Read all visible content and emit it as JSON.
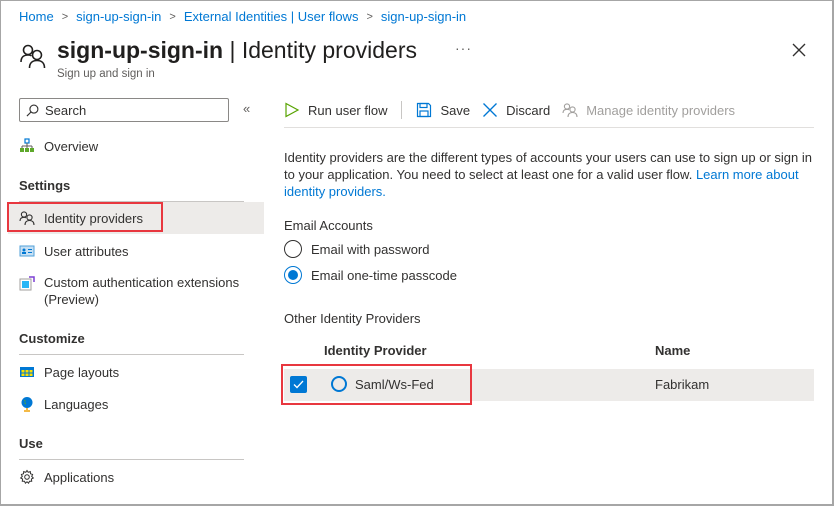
{
  "breadcrumb": [
    {
      "label": "Home"
    },
    {
      "label": "sign-up-sign-in"
    },
    {
      "label": "External Identities | User flows"
    },
    {
      "label": "sign-up-sign-in"
    }
  ],
  "breadcrumb_separator": ">",
  "header": {
    "title_bold": "sign-up-sign-in",
    "title_rest": " | Identity providers",
    "subtitle": "Sign up and sign in",
    "more_label": "···",
    "icon": "people-icon",
    "close_icon": "close-icon"
  },
  "sidebar": {
    "search_placeholder": "Search",
    "collapse_label": "«",
    "overview": {
      "label": "Overview",
      "icon": "org-chart-icon"
    },
    "groups": [
      {
        "label": "Settings",
        "items": [
          {
            "label": "Identity providers",
            "icon": "people-icon",
            "active": true
          },
          {
            "label": "User attributes",
            "icon": "id-card-icon"
          },
          {
            "label": "Custom authentication extensions (Preview)",
            "icon": "extension-icon"
          }
        ]
      },
      {
        "label": "Customize",
        "items": [
          {
            "label": "Page layouts",
            "icon": "table-layout-icon"
          },
          {
            "label": "Languages",
            "icon": "globe-icon"
          }
        ]
      },
      {
        "label": "Use",
        "items": [
          {
            "label": "Applications",
            "icon": "gear-icon"
          }
        ]
      }
    ]
  },
  "toolbar": {
    "run_label": "Run user flow",
    "save_label": "Save",
    "discard_label": "Discard",
    "manage_label": "Manage identity providers"
  },
  "content": {
    "description": "Identity providers are the different types of accounts your users can use to sign up or sign in to your application. You need to select at least one for a valid user flow. ",
    "learn_more": "Learn more about identity providers.",
    "email_section": "Email Accounts",
    "email_options": [
      {
        "label": "Email with password",
        "checked": false
      },
      {
        "label": "Email one-time passcode",
        "checked": true
      }
    ],
    "other_section": "Other Identity Providers",
    "table": {
      "columns": [
        "Identity Provider",
        "Name"
      ],
      "rows": [
        {
          "provider": "Saml/Ws-Fed",
          "name": "Fabrikam",
          "selected": true
        }
      ]
    }
  },
  "colors": {
    "accent": "#0078d4",
    "highlight": "#e8373f",
    "selected_bg": "#edebe9"
  }
}
